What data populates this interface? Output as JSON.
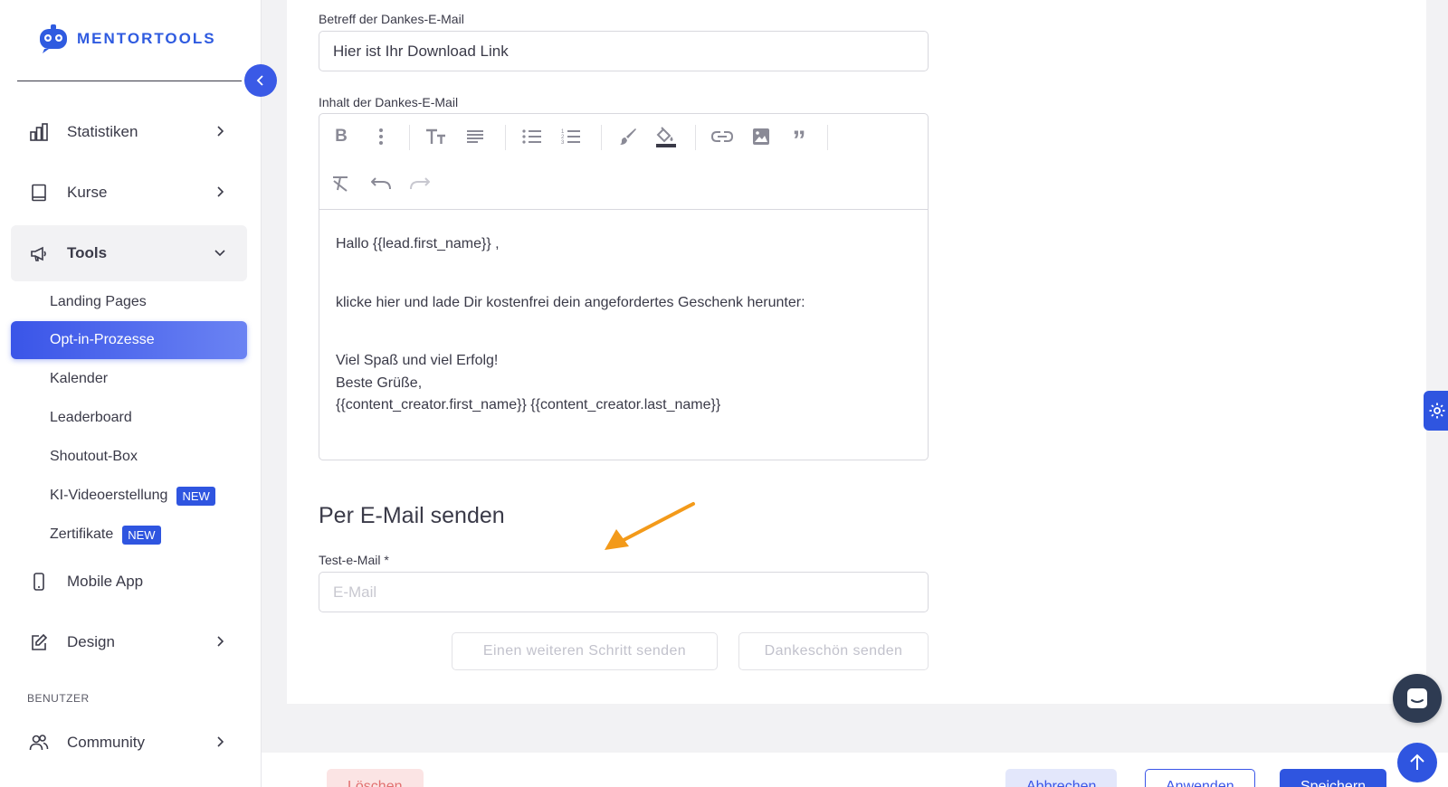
{
  "brand": {
    "name": "MENTORTOOLS",
    "accent": "#2f55e0"
  },
  "sidebar": {
    "items": [
      {
        "label": "Statistiken",
        "icon": "bar-chart-icon"
      },
      {
        "label": "Kurse",
        "icon": "book-icon"
      },
      {
        "label": "Tools",
        "icon": "megaphone-icon"
      },
      {
        "label": "Mobile App",
        "icon": "smartphone-icon"
      },
      {
        "label": "Design",
        "icon": "edit-icon"
      },
      {
        "label": "Community",
        "icon": "users-icon"
      }
    ],
    "tools_sub": [
      {
        "label": "Landing Pages"
      },
      {
        "label": "Opt-in-Prozesse"
      },
      {
        "label": "Kalender"
      },
      {
        "label": "Leaderboard"
      },
      {
        "label": "Shoutout-Box"
      },
      {
        "label": "KI-Videoerstellung",
        "badge": "NEW"
      },
      {
        "label": "Zertifikate",
        "badge": "NEW"
      }
    ],
    "section_benutzer": "BENUTZER"
  },
  "form": {
    "subject_label": "Betreff der Dankes-E-Mail",
    "subject_value": "Hier ist Ihr Download Link",
    "content_label": "Inhalt der Dankes-E-Mail",
    "editor_lines": {
      "greeting": "Hallo {{lead.first_name}} ,",
      "body": "klicke hier und lade Dir kostenfrei dein angefordertes Geschenk herunter:",
      "closing1": "Viel Spaß und viel Erfolg!",
      "closing2": "Beste Grüße,",
      "signature": "{{content_creator.first_name}} {{content_creator.last_name}}"
    },
    "send_section_title": "Per E-Mail senden",
    "test_email_label": "Test-e-Mail *",
    "test_email_placeholder": "E-Mail",
    "send_step_button": "Einen weiteren Schritt senden",
    "send_thanks_button": "Dankeschön senden"
  },
  "footer": {
    "delete": "Löschen",
    "cancel": "Abbrechen",
    "apply": "Anwenden",
    "save": "Speichern"
  }
}
